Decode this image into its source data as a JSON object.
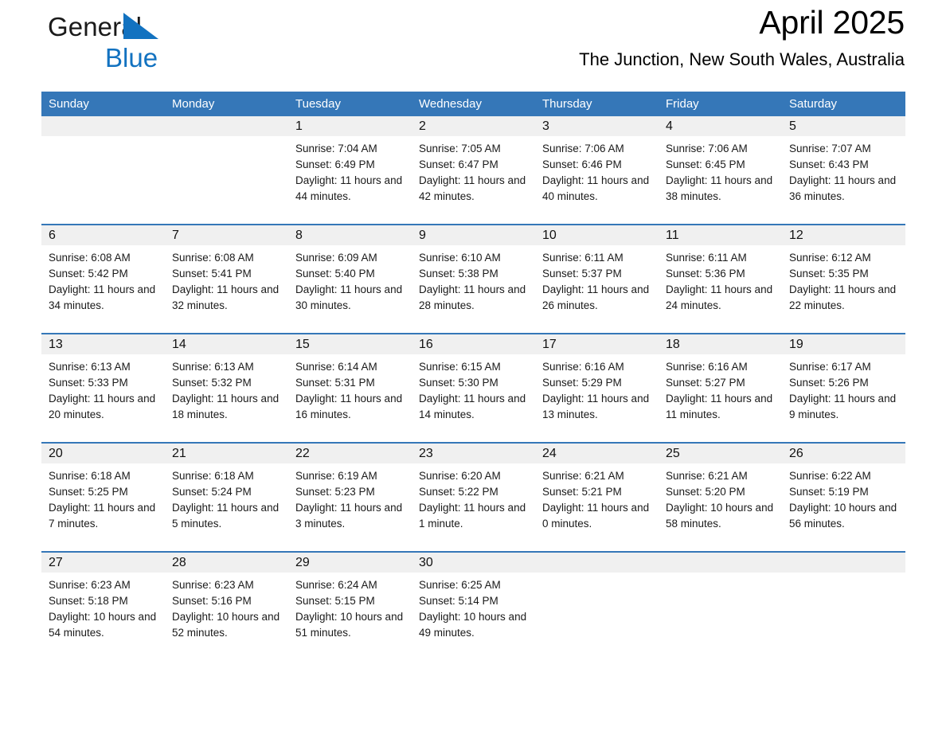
{
  "brand": {
    "name_part1": "General",
    "name_part2": "Blue",
    "triangle_color": "#1272c0",
    "blue_text_color": "#1272c0"
  },
  "header": {
    "month_title": "April 2025",
    "location": "The Junction, New South Wales, Australia"
  },
  "theme": {
    "header_blue": "#3577b8",
    "row_divider_blue": "#3577b8",
    "daynum_band": "#f0f0f0",
    "page_background": "#ffffff"
  },
  "calendar": {
    "weekday_headers": [
      "Sunday",
      "Monday",
      "Tuesday",
      "Wednesday",
      "Thursday",
      "Friday",
      "Saturday"
    ],
    "weeks": [
      [
        {
          "day": "",
          "sunrise": "",
          "sunset": "",
          "daylight": ""
        },
        {
          "day": "",
          "sunrise": "",
          "sunset": "",
          "daylight": ""
        },
        {
          "day": "1",
          "sunrise": "Sunrise: 7:04 AM",
          "sunset": "Sunset: 6:49 PM",
          "daylight": "Daylight: 11 hours and 44 minutes."
        },
        {
          "day": "2",
          "sunrise": "Sunrise: 7:05 AM",
          "sunset": "Sunset: 6:47 PM",
          "daylight": "Daylight: 11 hours and 42 minutes."
        },
        {
          "day": "3",
          "sunrise": "Sunrise: 7:06 AM",
          "sunset": "Sunset: 6:46 PM",
          "daylight": "Daylight: 11 hours and 40 minutes."
        },
        {
          "day": "4",
          "sunrise": "Sunrise: 7:06 AM",
          "sunset": "Sunset: 6:45 PM",
          "daylight": "Daylight: 11 hours and 38 minutes."
        },
        {
          "day": "5",
          "sunrise": "Sunrise: 7:07 AM",
          "sunset": "Sunset: 6:43 PM",
          "daylight": "Daylight: 11 hours and 36 minutes."
        }
      ],
      [
        {
          "day": "6",
          "sunrise": "Sunrise: 6:08 AM",
          "sunset": "Sunset: 5:42 PM",
          "daylight": "Daylight: 11 hours and 34 minutes."
        },
        {
          "day": "7",
          "sunrise": "Sunrise: 6:08 AM",
          "sunset": "Sunset: 5:41 PM",
          "daylight": "Daylight: 11 hours and 32 minutes."
        },
        {
          "day": "8",
          "sunrise": "Sunrise: 6:09 AM",
          "sunset": "Sunset: 5:40 PM",
          "daylight": "Daylight: 11 hours and 30 minutes."
        },
        {
          "day": "9",
          "sunrise": "Sunrise: 6:10 AM",
          "sunset": "Sunset: 5:38 PM",
          "daylight": "Daylight: 11 hours and 28 minutes."
        },
        {
          "day": "10",
          "sunrise": "Sunrise: 6:11 AM",
          "sunset": "Sunset: 5:37 PM",
          "daylight": "Daylight: 11 hours and 26 minutes."
        },
        {
          "day": "11",
          "sunrise": "Sunrise: 6:11 AM",
          "sunset": "Sunset: 5:36 PM",
          "daylight": "Daylight: 11 hours and 24 minutes."
        },
        {
          "day": "12",
          "sunrise": "Sunrise: 6:12 AM",
          "sunset": "Sunset: 5:35 PM",
          "daylight": "Daylight: 11 hours and 22 minutes."
        }
      ],
      [
        {
          "day": "13",
          "sunrise": "Sunrise: 6:13 AM",
          "sunset": "Sunset: 5:33 PM",
          "daylight": "Daylight: 11 hours and 20 minutes."
        },
        {
          "day": "14",
          "sunrise": "Sunrise: 6:13 AM",
          "sunset": "Sunset: 5:32 PM",
          "daylight": "Daylight: 11 hours and 18 minutes."
        },
        {
          "day": "15",
          "sunrise": "Sunrise: 6:14 AM",
          "sunset": "Sunset: 5:31 PM",
          "daylight": "Daylight: 11 hours and 16 minutes."
        },
        {
          "day": "16",
          "sunrise": "Sunrise: 6:15 AM",
          "sunset": "Sunset: 5:30 PM",
          "daylight": "Daylight: 11 hours and 14 minutes."
        },
        {
          "day": "17",
          "sunrise": "Sunrise: 6:16 AM",
          "sunset": "Sunset: 5:29 PM",
          "daylight": "Daylight: 11 hours and 13 minutes."
        },
        {
          "day": "18",
          "sunrise": "Sunrise: 6:16 AM",
          "sunset": "Sunset: 5:27 PM",
          "daylight": "Daylight: 11 hours and 11 minutes."
        },
        {
          "day": "19",
          "sunrise": "Sunrise: 6:17 AM",
          "sunset": "Sunset: 5:26 PM",
          "daylight": "Daylight: 11 hours and 9 minutes."
        }
      ],
      [
        {
          "day": "20",
          "sunrise": "Sunrise: 6:18 AM",
          "sunset": "Sunset: 5:25 PM",
          "daylight": "Daylight: 11 hours and 7 minutes."
        },
        {
          "day": "21",
          "sunrise": "Sunrise: 6:18 AM",
          "sunset": "Sunset: 5:24 PM",
          "daylight": "Daylight: 11 hours and 5 minutes."
        },
        {
          "day": "22",
          "sunrise": "Sunrise: 6:19 AM",
          "sunset": "Sunset: 5:23 PM",
          "daylight": "Daylight: 11 hours and 3 minutes."
        },
        {
          "day": "23",
          "sunrise": "Sunrise: 6:20 AM",
          "sunset": "Sunset: 5:22 PM",
          "daylight": "Daylight: 11 hours and 1 minute."
        },
        {
          "day": "24",
          "sunrise": "Sunrise: 6:21 AM",
          "sunset": "Sunset: 5:21 PM",
          "daylight": "Daylight: 11 hours and 0 minutes."
        },
        {
          "day": "25",
          "sunrise": "Sunrise: 6:21 AM",
          "sunset": "Sunset: 5:20 PM",
          "daylight": "Daylight: 10 hours and 58 minutes."
        },
        {
          "day": "26",
          "sunrise": "Sunrise: 6:22 AM",
          "sunset": "Sunset: 5:19 PM",
          "daylight": "Daylight: 10 hours and 56 minutes."
        }
      ],
      [
        {
          "day": "27",
          "sunrise": "Sunrise: 6:23 AM",
          "sunset": "Sunset: 5:18 PM",
          "daylight": "Daylight: 10 hours and 54 minutes."
        },
        {
          "day": "28",
          "sunrise": "Sunrise: 6:23 AM",
          "sunset": "Sunset: 5:16 PM",
          "daylight": "Daylight: 10 hours and 52 minutes."
        },
        {
          "day": "29",
          "sunrise": "Sunrise: 6:24 AM",
          "sunset": "Sunset: 5:15 PM",
          "daylight": "Daylight: 10 hours and 51 minutes."
        },
        {
          "day": "30",
          "sunrise": "Sunrise: 6:25 AM",
          "sunset": "Sunset: 5:14 PM",
          "daylight": "Daylight: 10 hours and 49 minutes."
        },
        {
          "day": "",
          "sunrise": "",
          "sunset": "",
          "daylight": ""
        },
        {
          "day": "",
          "sunrise": "",
          "sunset": "",
          "daylight": ""
        },
        {
          "day": "",
          "sunrise": "",
          "sunset": "",
          "daylight": ""
        }
      ]
    ]
  }
}
